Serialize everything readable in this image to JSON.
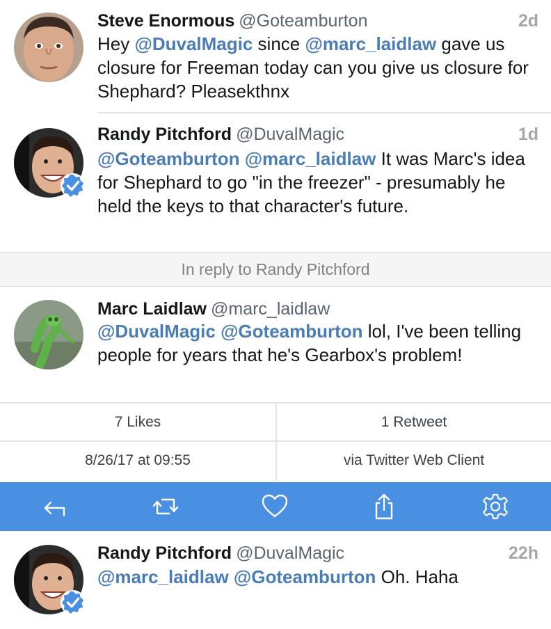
{
  "tweets": [
    {
      "name": "Steve Enormous",
      "handle": "@Goteamburton",
      "time": "2d",
      "mention1": "@DuvalMagic",
      "text1": " since ",
      "mention2": "@marc_laidlaw",
      "text2": " gave us closure for Freeman today can you give us closure for Shephard? Pleasekthnx",
      "prefix": "Hey "
    },
    {
      "name": "Randy Pitchford",
      "handle": "@DuvalMagic",
      "time": "1d",
      "mention1": "@Goteamburton",
      "mention2": "@marc_laidlaw",
      "text": " It was Marc's idea for Shephard to go \"in the freezer\" - presumably he held the keys to that character's future."
    },
    {
      "name": "Marc Laidlaw",
      "handle": "@marc_laidlaw",
      "mention1": "@DuvalMagic",
      "mention2": "@Goteamburton",
      "text": " lol, I've been telling people for years that he's Gearbox's problem!"
    },
    {
      "name": "Randy Pitchford",
      "handle": "@DuvalMagic",
      "time": "22h",
      "mention1": "@marc_laidlaw",
      "mention2": "@Goteamburton",
      "text": " Oh.  Haha"
    }
  ],
  "reply_banner": "In reply to Randy Pitchford",
  "stats": {
    "likes": "7 Likes",
    "retweets": "1 Retweet",
    "date": "8/26/17 at 09:55",
    "client": "via Twitter Web Client"
  },
  "actions": [
    "reply-icon",
    "retweet-icon",
    "like-icon",
    "share-icon",
    "settings-icon"
  ],
  "colors": {
    "mention": "#4a7db5",
    "action_bar": "#4a90e2",
    "verified": "#4a90e2"
  }
}
